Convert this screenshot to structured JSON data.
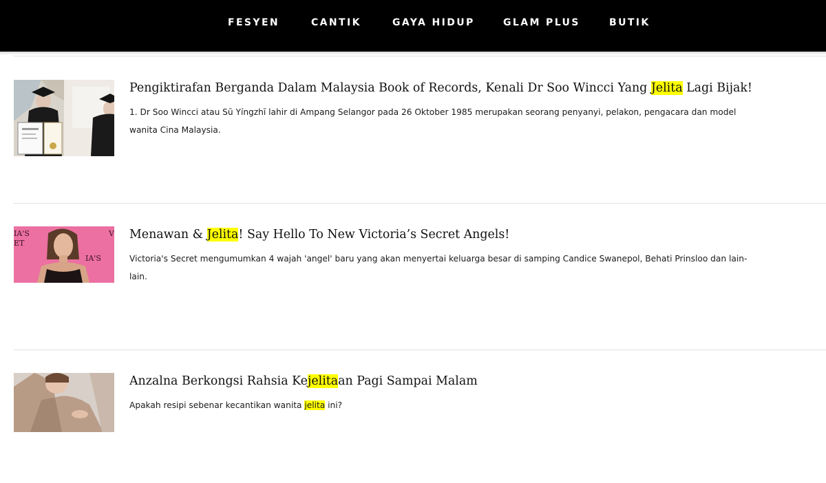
{
  "nav": {
    "items": [
      "FESYEN",
      "CANTIK",
      "GAYA HIDUP",
      "GLAM PLUS",
      "BUTIK"
    ],
    "background": "#000000"
  },
  "highlight_color": "#ffff00",
  "articles": [
    {
      "title_parts": [
        "Pengiktirafan Berganda Dalam Malaysia Book of Records, Kenali Dr Soo Wincci Yang ",
        "Jelita",
        " Lagi Bijak!"
      ],
      "excerpt_lines": [
        [
          " 1. Dr Soo Wincci atau Sū Yíngzhī lahir di Ampang Selangor pada 26 Oktober 1985 merupakan seorang penyanyi, pelakon, pengacara dan model"
        ],
        [
          "wanita Cina Malaysia."
        ]
      ]
    },
    {
      "title_parts": [
        "Menawan & ",
        "Jelita",
        "! Say Hello To New Victoria’s Secret Angels!"
      ],
      "excerpt_lines": [
        [
          "Victoria's Secret mengumumkan 4 wajah 'angel' baru yang akan menyertai keluarga besar di samping Candice Swanepol, Behati Prinsloo dan lain-"
        ],
        [
          "lain."
        ]
      ]
    },
    {
      "title_parts": [
        "Anzalna Berkongsi Rahsia Ke",
        "jelita",
        "an Pagi Sampai Malam"
      ],
      "excerpt_lines": [
        [
          "Apakah resipi sebenar kecantikan wanita ",
          "jelita",
          " ini?"
        ]
      ]
    }
  ]
}
